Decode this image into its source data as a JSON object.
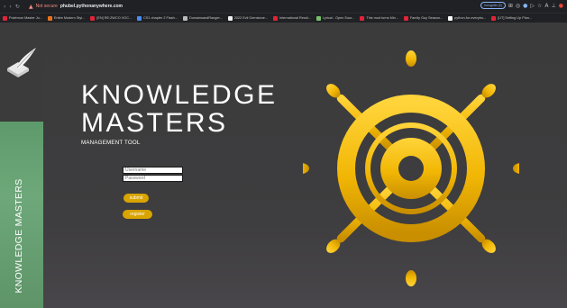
{
  "browser": {
    "security_label": "Not secure",
    "url_domain": "phubel.pythonanywhere.com",
    "profile_label": "Incognito (2)",
    "bookmarks": [
      {
        "label": "Pokémon Master Ju...",
        "color": "#e0243a"
      },
      {
        "label": "Entire Modern Styl...",
        "color": "#e8731e"
      },
      {
        "label": "[EN] RE:ZWCO VOC...",
        "color": "#e0243a"
      },
      {
        "label": "CS1 chapter 2 Flash...",
        "color": "#4a8cf0"
      },
      {
        "label": "DomainsandRanger...",
        "color": "#bbbbbb"
      },
      {
        "label": "2022 Evil Gemstone...",
        "color": "#f0f0f0"
      },
      {
        "label": "International Resid...",
        "color": "#e0243a"
      },
      {
        "label": "Lyrical - Open Sour...",
        "color": "#79c06b"
      },
      {
        "label": "This mod turns Min...",
        "color": "#e0243a"
      },
      {
        "label": "Family Guy Season...",
        "color": "#e0243a"
      },
      {
        "label": "python-for-everybo...",
        "color": "#ffffff"
      },
      {
        "label": "[UT] Setting Up Plan...",
        "color": "#e0243a"
      }
    ]
  },
  "sidebar": {
    "vertical_label": "KNOWLEDGE MASTERS",
    "logo_icon": "feather-book-icon",
    "accent": "#6ea87a"
  },
  "hero": {
    "title_line1": "KNOWLEDGE",
    "title_line2": "MASTERS",
    "subtitle": "MANAGEMENT TOOL",
    "wheel_icon": "ship-wheel-icon",
    "wheel_color": "#f2b705"
  },
  "form": {
    "username_placeholder": "Username",
    "password_placeholder": "Password",
    "submit_label": "submit",
    "register_label": "register",
    "button_color": "#d9a400"
  }
}
